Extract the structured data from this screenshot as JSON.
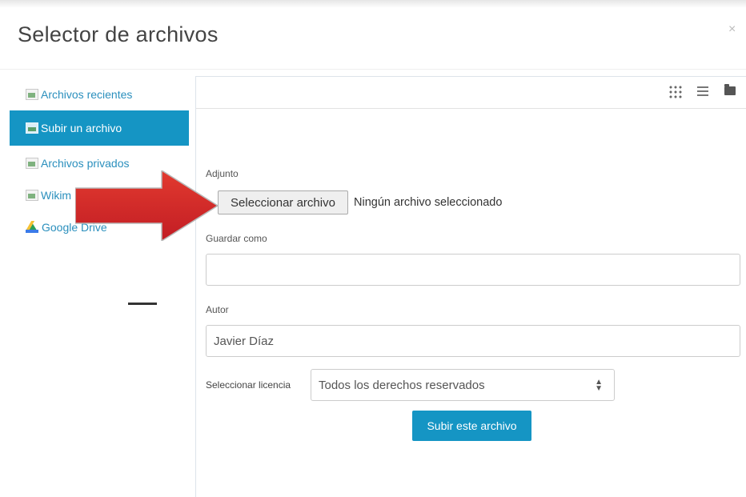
{
  "dialog": {
    "title": "Selector de archivos",
    "close": "×"
  },
  "sidebar": {
    "items": [
      {
        "label": "Archivos recientes",
        "icon": "broken-image-icon",
        "active": false
      },
      {
        "label": "Subir un archivo",
        "icon": "upload-icon",
        "active": true
      },
      {
        "label": "Archivos privados",
        "icon": "broken-image-icon",
        "active": false
      },
      {
        "label": "Wikim",
        "icon": "broken-image-icon",
        "active": false
      },
      {
        "label": "Google Drive",
        "icon": "google-drive-icon",
        "active": false
      }
    ]
  },
  "toolbar": {
    "views": [
      "grid-view-icon",
      "list-view-icon",
      "folder-view-icon"
    ]
  },
  "form": {
    "attachment_label": "Adjunto",
    "choose_file_button": "Seleccionar archivo",
    "file_status": "Ningún archivo seleccionado",
    "save_as_label": "Guardar como",
    "save_as_value": "",
    "author_label": "Autor",
    "author_value": "Javier Díaz",
    "license_label": "Seleccionar licencia",
    "license_value": "Todos los derechos reservados",
    "submit_button": "Subir este archivo"
  },
  "colors": {
    "accent": "#1595c4",
    "link": "#2a8fbd",
    "arrow": "#d9262b"
  }
}
